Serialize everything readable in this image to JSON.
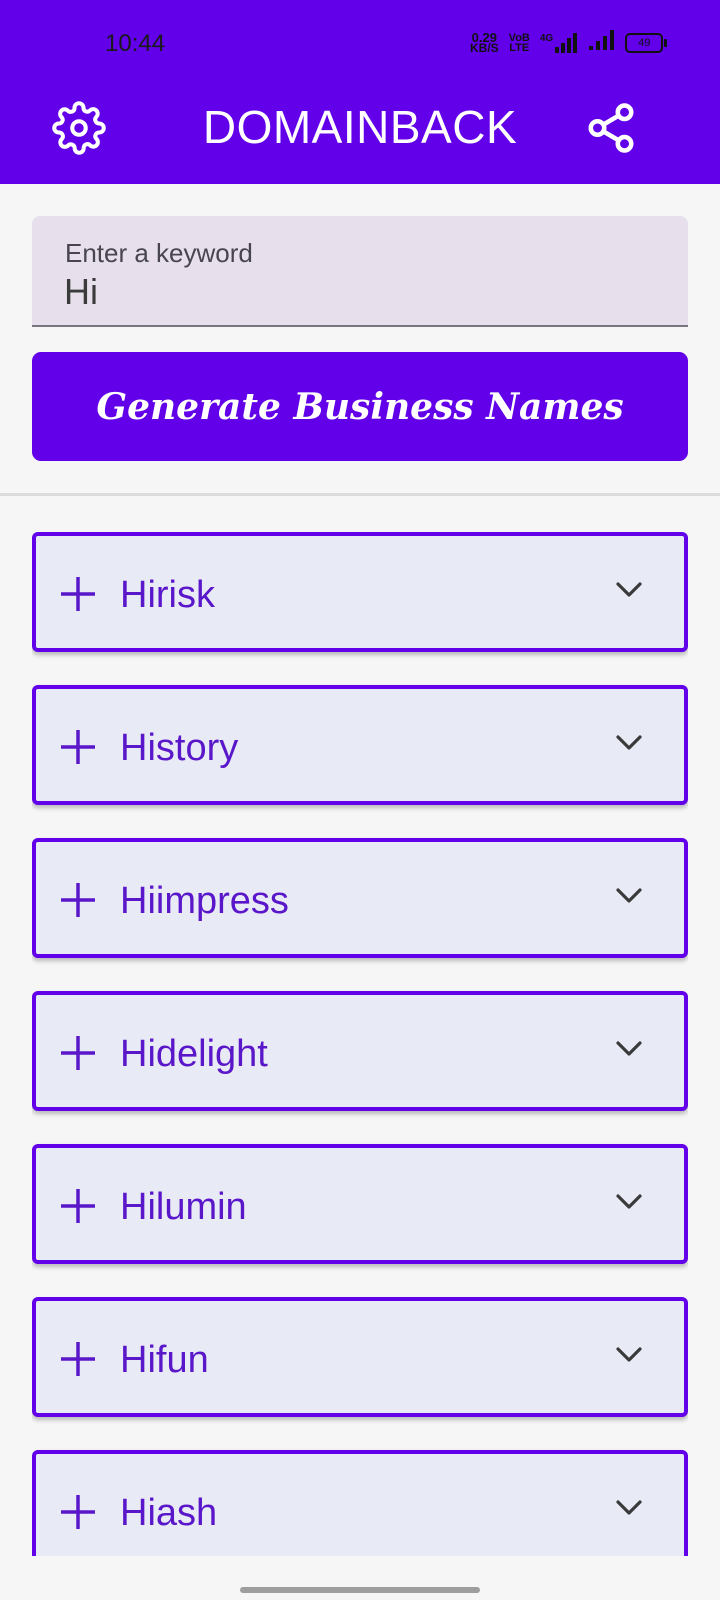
{
  "status_bar": {
    "time": "10:44",
    "net_speed": "0.29",
    "net_unit": "KB/S",
    "volte": "VoB",
    "lte": "LTE",
    "network": "4G",
    "battery": "49"
  },
  "appbar": {
    "title": "DOMAINBACK",
    "settings_icon": "gear-icon",
    "share_icon": "share-icon",
    "color": "#6200ea"
  },
  "search": {
    "label": "Enter a keyword",
    "value": "Hi"
  },
  "generate_button": {
    "label": "Generate Business Names"
  },
  "results": [
    {
      "name": "Hirisk"
    },
    {
      "name": "History"
    },
    {
      "name": "Hiimpress"
    },
    {
      "name": "Hidelight"
    },
    {
      "name": "Hilumin"
    },
    {
      "name": "Hifun"
    },
    {
      "name": "Hiash"
    }
  ]
}
